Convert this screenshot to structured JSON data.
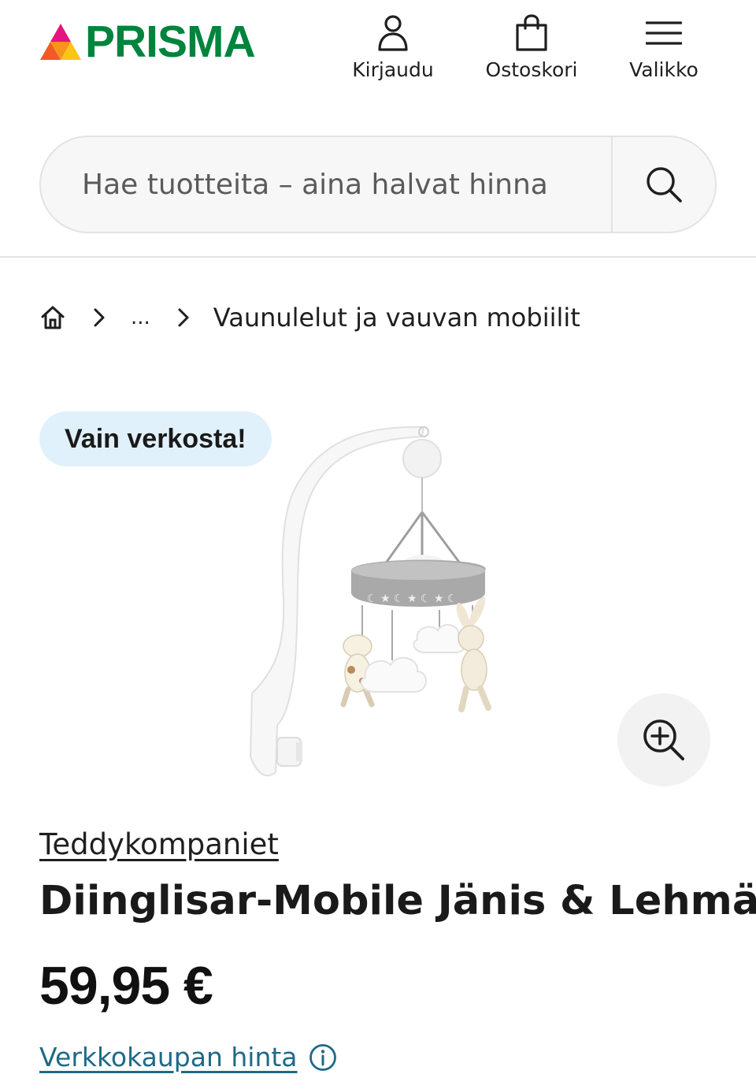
{
  "header": {
    "logo_text": "PRISMA",
    "nav": {
      "login_label": "Kirjaudu",
      "cart_label": "Ostoskori",
      "menu_label": "Valikko"
    }
  },
  "search": {
    "placeholder": "Hae tuotteita – aina halvat hinna"
  },
  "breadcrumb": {
    "ellipsis": "...",
    "current": "Vaunulelut ja vauvan mobiilit"
  },
  "product": {
    "badge": "Vain verkosta!",
    "brand": "Teddykompaniet",
    "title": "Diinglisar-Mobile Jänis & Lehmä",
    "price": "59,95 €",
    "price_note": "Verkkokaupan hinta"
  },
  "colors": {
    "brand_green": "#00843d",
    "link_blue": "#1e6a88",
    "badge_bg": "#e1f1fb"
  },
  "icons": {
    "login": "user-icon",
    "cart": "shopping-bag-icon",
    "menu": "hamburger-icon",
    "search": "search-icon",
    "home": "home-icon",
    "zoom": "zoom-in-icon",
    "info": "info-icon"
  }
}
